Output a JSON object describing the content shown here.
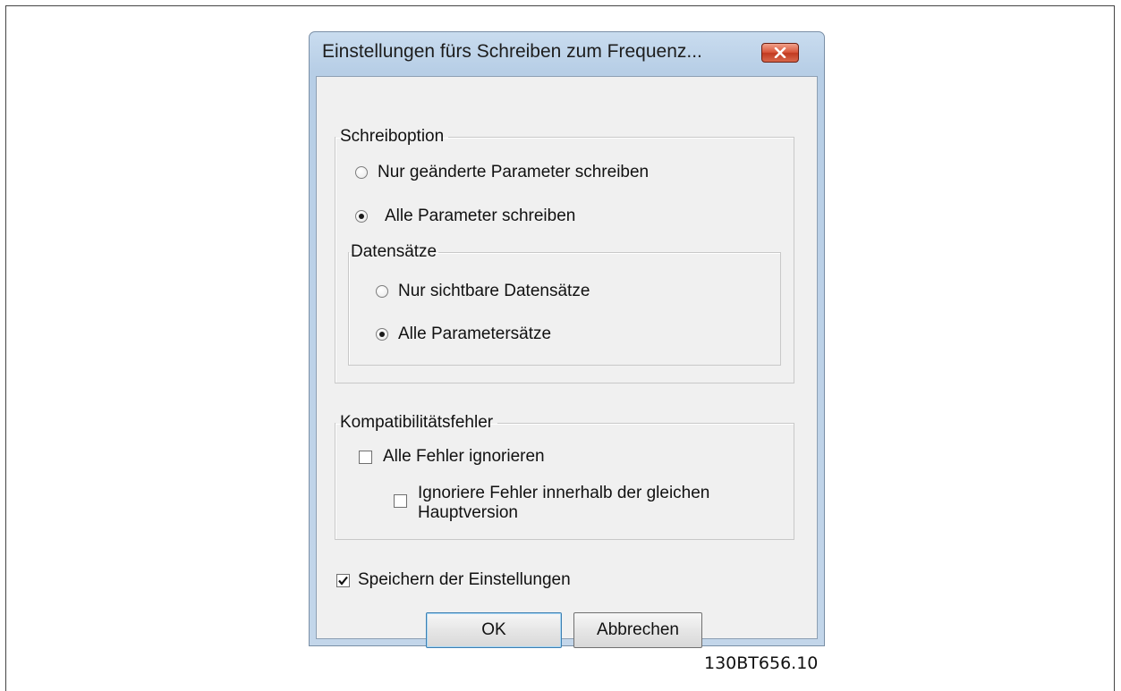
{
  "dialog": {
    "title": "Einstellungen fürs Schreiben zum Frequenz...",
    "close_icon": "close-icon"
  },
  "write_option": {
    "legend": "Schreiboption",
    "options": [
      {
        "label": "Nur geänderte Parameter schreiben",
        "selected": false
      },
      {
        "label": "Alle Parameter schreiben",
        "selected": true
      }
    ]
  },
  "data_sets": {
    "legend": "Datensätze",
    "options": [
      {
        "label": "Nur sichtbare Datensätze",
        "selected": false
      },
      {
        "label": "Alle Parametersätze",
        "selected": true
      }
    ]
  },
  "compatibility": {
    "legend": "Kompatibilitätsfehler",
    "ignore_all": {
      "label": "Alle Fehler ignorieren",
      "checked": false
    },
    "ignore_same_major": {
      "label_line1": "Ignoriere Fehler innerhalb der gleichen",
      "label_line2": "Hauptversion",
      "checked": false
    }
  },
  "save_settings": {
    "label": "Speichern der Einstellungen",
    "checked": true
  },
  "buttons": {
    "ok": "OK",
    "cancel": "Abbrechen"
  },
  "figure_id": "130BT656.10",
  "colors": {
    "title_bar": "#b7cee6",
    "close_button": "#c9462b",
    "dialog_body": "#f0f0f0",
    "default_button_border": "#3c7fb1"
  }
}
